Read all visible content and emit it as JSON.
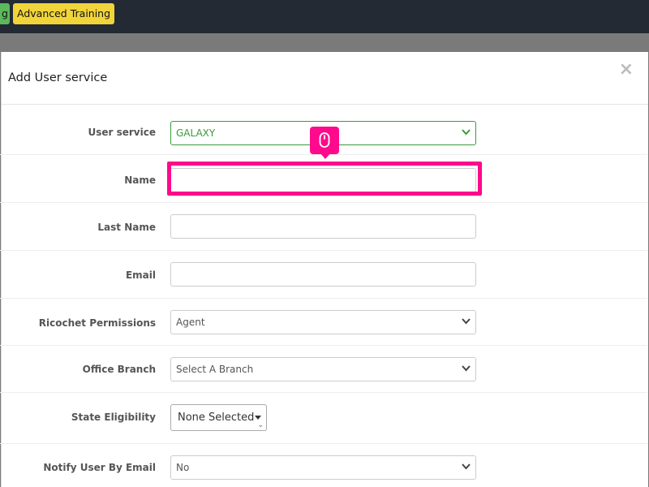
{
  "topbar": {
    "tag_partial": "g",
    "tag_training": "Advanced Training"
  },
  "modal": {
    "title": "Add User service",
    "close_icon": "close-icon"
  },
  "form": {
    "user_service": {
      "label": "User service",
      "value": "GALAXY"
    },
    "name": {
      "label": "Name",
      "value": ""
    },
    "last_name": {
      "label": "Last Name",
      "value": ""
    },
    "email": {
      "label": "Email",
      "value": ""
    },
    "permissions": {
      "label": "Ricochet Permissions",
      "value": "Agent"
    },
    "branch": {
      "label": "Office Branch",
      "value": "Select A Branch"
    },
    "state": {
      "label": "State Eligibility",
      "value": "None Selected"
    },
    "notify": {
      "label": "Notify User By Email",
      "value": "No"
    }
  },
  "colors": {
    "highlight": "#ff0a8c",
    "success_green": "#3c9a3c",
    "tag_yellow": "#f0d43a",
    "topbar": "#232a33"
  }
}
